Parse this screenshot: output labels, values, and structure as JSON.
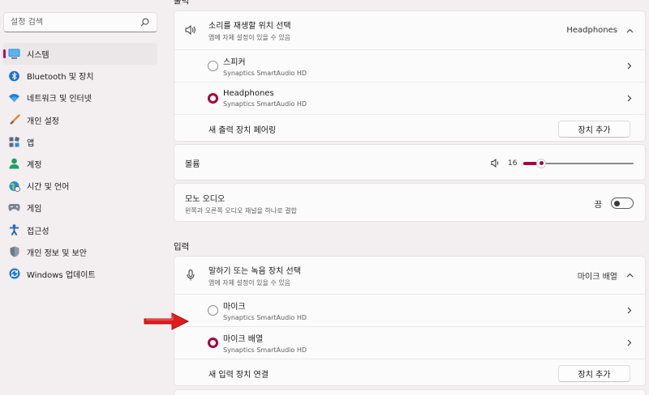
{
  "search": {
    "placeholder": "설정 검색"
  },
  "nav": {
    "items": [
      {
        "label": "시스템",
        "icon": "system-monitor-icon",
        "active": true
      },
      {
        "label": "Bluetooth 및 장치",
        "icon": "bluetooth-icon"
      },
      {
        "label": "네트워크 및 인터넷",
        "icon": "wifi-icon"
      },
      {
        "label": "개인 설정",
        "icon": "paintbrush-icon"
      },
      {
        "label": "앱",
        "icon": "apps-icon"
      },
      {
        "label": "계정",
        "icon": "account-icon"
      },
      {
        "label": "시간 및 언어",
        "icon": "globe-clock-icon"
      },
      {
        "label": "게임",
        "icon": "gamepad-icon"
      },
      {
        "label": "접근성",
        "icon": "accessibility-icon"
      },
      {
        "label": "개인 정보 및 보안",
        "icon": "shield-icon"
      },
      {
        "label": "Windows 업데이트",
        "icon": "update-icon"
      }
    ]
  },
  "output": {
    "section_title": "출력",
    "select": {
      "label": "소리를 재생할 위치 선택",
      "sub": "앱에 자체 설정이 있을 수 있음",
      "value": "Headphones"
    },
    "devices": [
      {
        "name": "스피커",
        "driver": "Synaptics SmartAudio HD",
        "selected": false
      },
      {
        "name": "Headphones",
        "driver": "Synaptics SmartAudio HD",
        "selected": true
      }
    ],
    "pair": {
      "label": "새 출력 장치 페어링",
      "button": "장치 추가"
    }
  },
  "volume": {
    "label": "볼륨",
    "value": 16
  },
  "mono": {
    "label": "모노 오디오",
    "sub": "왼쪽과 오른쪽 오디오 채널을 하나로 결합",
    "state": "끔"
  },
  "input": {
    "section_title": "입력",
    "select": {
      "label": "말하기 또는 녹음 장치 선택",
      "sub": "앱에 자체 설정이 있을 수 있음",
      "value": "마이크 배열"
    },
    "devices": [
      {
        "name": "마이크",
        "driver": "Synaptics SmartAudio HD",
        "selected": false
      },
      {
        "name": "마이크 배열",
        "driver": "Synaptics SmartAudio HD",
        "selected": true
      }
    ],
    "connect": {
      "label": "새 입력 장치 연결",
      "button": "장치 추가"
    }
  },
  "colors": {
    "accent": "#a5003f",
    "annotation_arrow": "#e11b1b"
  }
}
